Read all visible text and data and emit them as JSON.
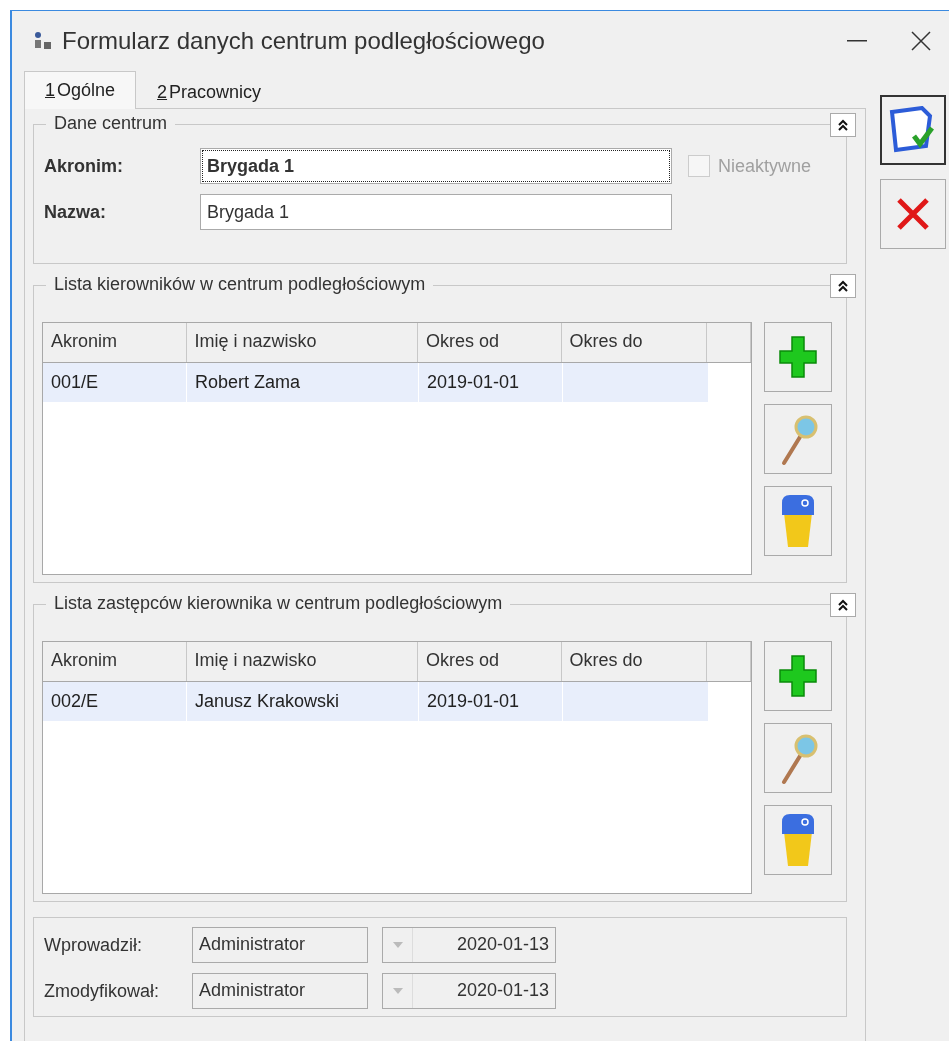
{
  "window": {
    "title": "Formularz danych centrum podległościowego"
  },
  "tabs": [
    {
      "key": "1",
      "label": "Ogólne",
      "selected": true
    },
    {
      "key": "2",
      "label": "Pracownicy",
      "selected": false
    }
  ],
  "basic": {
    "title": "Dane centrum",
    "fields": [
      {
        "label": "Akronim:",
        "value": "Brygada 1",
        "bold": true,
        "focused": true
      },
      {
        "label": "Nazwa:",
        "value": "Brygada 1",
        "bold": false,
        "focused": false
      }
    ],
    "inactive": {
      "label": "Nieaktywne",
      "checked": false,
      "disabled": true
    }
  },
  "lists": [
    {
      "title": "Lista kierowników w centrum podległościowym",
      "columns": [
        "Akronim",
        "Imię i nazwisko",
        "Okres od",
        "Okres do"
      ],
      "rows": [
        {
          "cells": [
            "001/E",
            "Robert Zama",
            "2019-01-01",
            ""
          ],
          "selected": true
        }
      ]
    },
    {
      "title": "Lista zastępców kierownika w centrum podległościowym",
      "columns": [
        "Akronim",
        "Imię i nazwisko",
        "Okres od",
        "Okres do"
      ],
      "rows": [
        {
          "cells": [
            "002/E",
            "Janusz Krakowski",
            "2019-01-01",
            ""
          ],
          "selected": true
        }
      ]
    }
  ],
  "footer": [
    {
      "label": "Wprowadził:",
      "user": "Administrator",
      "date": "2020-01-13"
    },
    {
      "label": "Zmodyfikował:",
      "user": "Administrator",
      "date": "2020-01-13"
    }
  ]
}
